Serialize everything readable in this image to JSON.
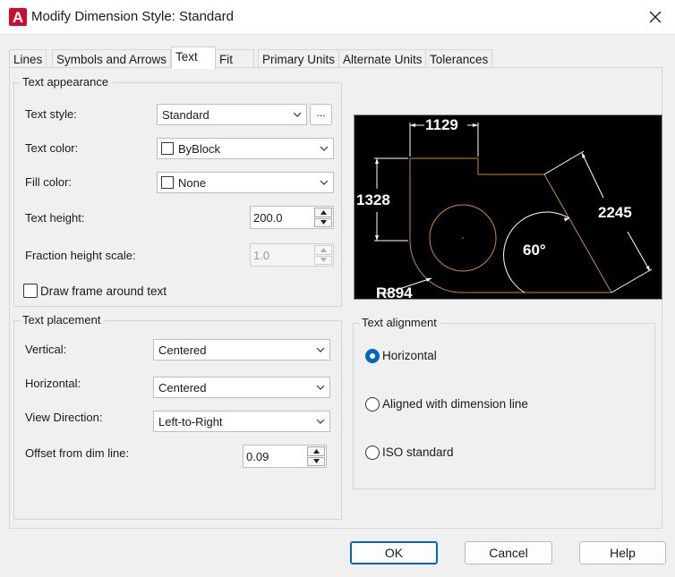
{
  "window": {
    "title": "Modify Dimension Style: Standard",
    "logo_letter": "A"
  },
  "tabs": [
    "Lines",
    "Symbols and Arrows",
    "Text",
    "Fit",
    "Primary Units",
    "Alternate Units",
    "Tolerances"
  ],
  "active_tab": "Text",
  "text_appearance": {
    "title": "Text appearance",
    "text_style": {
      "label": "Text style:",
      "value": "Standard",
      "browse_label": "..."
    },
    "text_color": {
      "label": "Text color:",
      "value": "ByBlock"
    },
    "fill_color": {
      "label": "Fill color:",
      "value": "None"
    },
    "text_height": {
      "label": "Text height:",
      "value": "200.0"
    },
    "fraction_height_scale": {
      "label": "Fraction height scale:",
      "value": "1.0",
      "enabled": false
    },
    "draw_frame": {
      "label": "Draw frame around text",
      "checked": false
    }
  },
  "text_placement": {
    "title": "Text placement",
    "vertical": {
      "label": "Vertical:",
      "value": "Centered"
    },
    "horizontal": {
      "label": "Horizontal:",
      "value": "Centered"
    },
    "view_direction": {
      "label": "View Direction:",
      "value": "Left-to-Right"
    },
    "offset": {
      "label": "Offset from dim line:",
      "value": "0.09"
    }
  },
  "text_alignment": {
    "title": "Text alignment",
    "options": [
      {
        "label": "Horizontal",
        "checked": true
      },
      {
        "label": "Aligned with dimension line",
        "checked": false
      },
      {
        "label": "ISO standard",
        "checked": false
      }
    ]
  },
  "preview": {
    "dim_top": "1129",
    "dim_left": "1328",
    "dim_right": "2245",
    "dim_angle": "60°",
    "dim_radius": "R894"
  },
  "buttons": {
    "ok": "OK",
    "cancel": "Cancel",
    "help": "Help"
  },
  "colors": {
    "accent": "#0067c0",
    "logo_red": "#c8102e",
    "preview_bg": "#000000",
    "preview_geometry": "#c98a3a",
    "preview_dims": "#ffffff"
  }
}
